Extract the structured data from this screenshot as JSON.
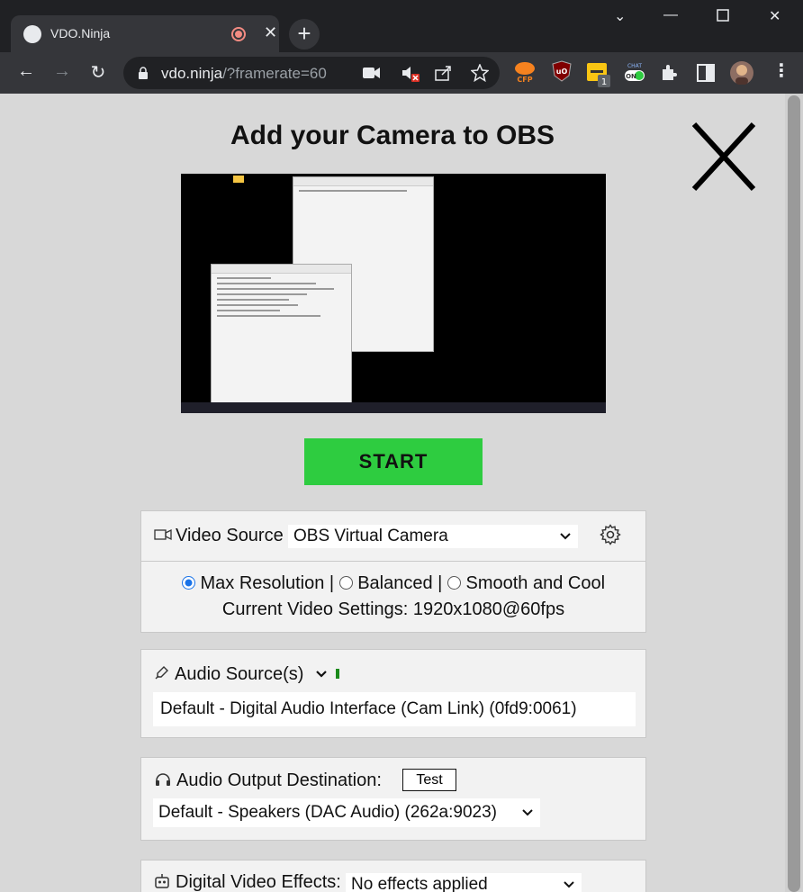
{
  "browser": {
    "tab": {
      "title": "VDO.Ninja"
    },
    "address": {
      "host": "vdo.ninja",
      "path": "/?framerate=60"
    },
    "extensions": {
      "badge_count": "1",
      "cfp_label": "CFP",
      "chat_label": "CHAT",
      "chat_on": "ON"
    }
  },
  "page": {
    "heading": "Add your Camera to OBS",
    "start_label": "START",
    "video": {
      "label": "Video Source",
      "selected": "OBS Virtual Camera",
      "res_max": "Max Resolution |",
      "res_balanced": "Balanced |",
      "res_smooth": "Smooth and Cool",
      "current_settings": "Current Video Settings: 1920x1080@60fps"
    },
    "audio_source": {
      "label": "Audio Source(s)",
      "device": "Default - Digital Audio Interface (Cam Link) (0fd9:0061)"
    },
    "audio_output": {
      "label": "Audio Output Destination:",
      "test_label": "Test",
      "selected": "Default - Speakers (DAC Audio) (262a:9023)"
    },
    "effects": {
      "label": "Digital Video Effects:",
      "selected": "No effects applied"
    }
  },
  "colors": {
    "start_button": "#2ecc40",
    "chrome_dark": "#202124",
    "chrome_toolbar": "#35363a",
    "page_bg": "#d8d8d8"
  }
}
